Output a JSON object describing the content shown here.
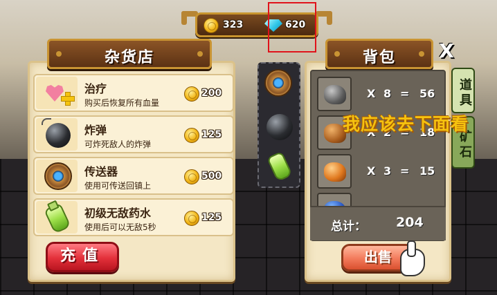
{
  "currency": {
    "gold": "323",
    "gems": "620"
  },
  "shop": {
    "title": "杂货店",
    "items": [
      {
        "name": "治疗",
        "desc": "购买后恢复所有血量",
        "price": "200",
        "icon": "heal-heart-icon"
      },
      {
        "name": "炸弹",
        "desc": "可炸死敌人的炸弹",
        "price": "125",
        "icon": "bomb-icon"
      },
      {
        "name": "传送器",
        "desc": "使用可传送回镇上",
        "price": "500",
        "icon": "teleporter-icon"
      },
      {
        "name": "初级无敌药水",
        "desc": "使用后可以无敌5秒",
        "price": "125",
        "icon": "potion-icon"
      }
    ],
    "recharge_label": "充值"
  },
  "quick_slots": [
    "teleporter-icon",
    "bomb-icon",
    "potion-icon"
  ],
  "bag": {
    "title": "背包",
    "rows": [
      {
        "x": "X",
        "qty": "8",
        "eq": "=",
        "value": "56",
        "icon": "stone-ore-icon"
      },
      {
        "x": "X",
        "qty": "2",
        "eq": "=",
        "value": "18",
        "icon": "copper-ore-icon"
      },
      {
        "x": "X",
        "qty": "3",
        "eq": "=",
        "value": "15",
        "icon": "amber-ore-icon"
      }
    ],
    "total_label": "总计：",
    "total_value": "204",
    "sell_label": "出售",
    "tabs": [
      "道具",
      "矿石"
    ],
    "close_label": "X"
  },
  "overlay_text": "我应该去下面看"
}
